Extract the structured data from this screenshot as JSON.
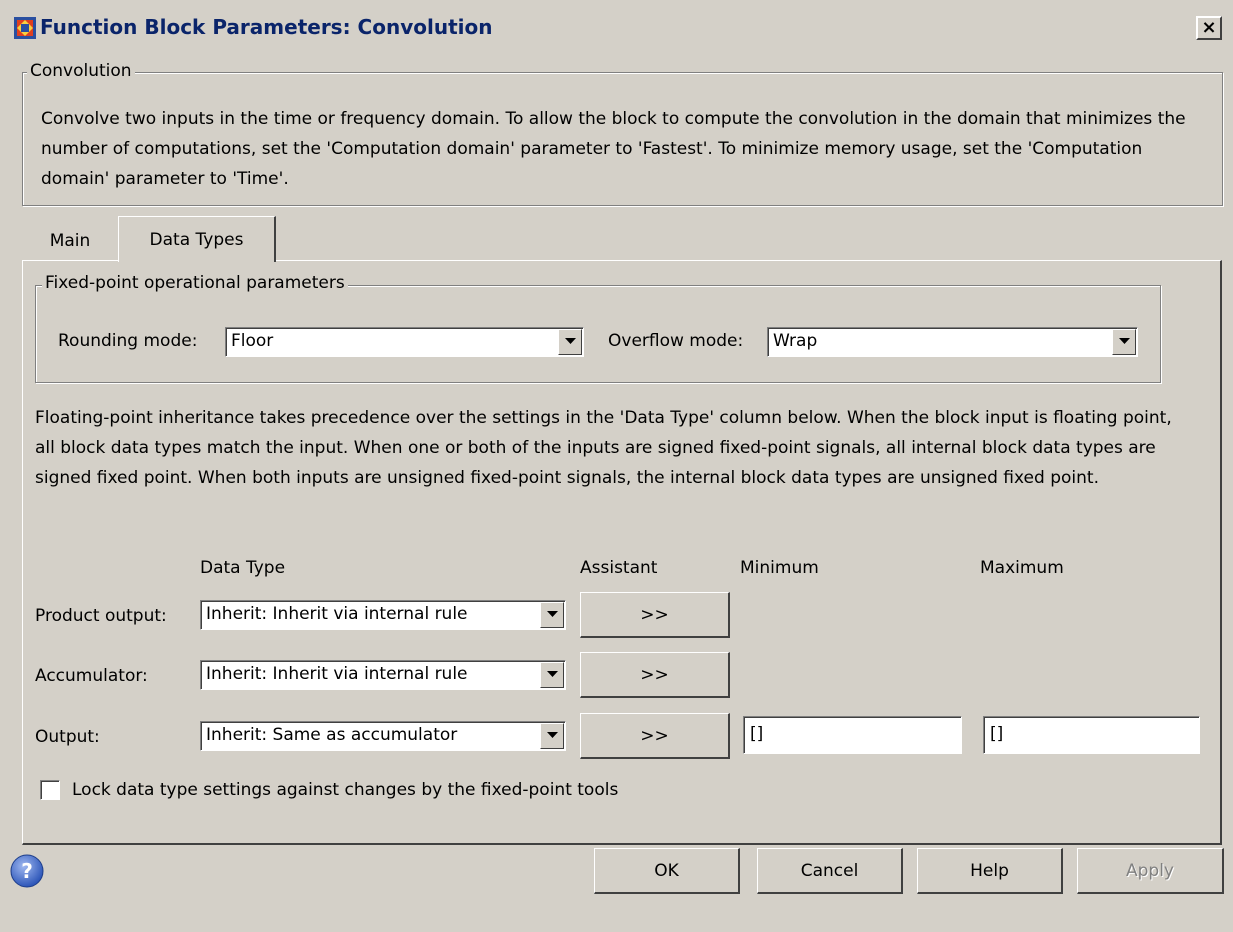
{
  "window": {
    "title": "Function Block Parameters: Convolution",
    "close_label": "×"
  },
  "block_group": {
    "legend": "Convolution",
    "description": "Convolve two inputs in the time or frequency domain. To allow the block to compute the convolution in the domain that minimizes the number of computations, set the 'Computation domain' parameter to 'Fastest'. To minimize memory usage, set the 'Computation domain' parameter to 'Time'."
  },
  "tabs": [
    {
      "label": "Main",
      "active": false
    },
    {
      "label": "Data Types",
      "active": true
    }
  ],
  "fixed_point": {
    "legend": "Fixed-point operational parameters",
    "rounding_label": "Rounding mode:",
    "rounding_value": "Floor",
    "overflow_label": "Overflow mode:",
    "overflow_value": "Wrap"
  },
  "inheritance_text": "Floating-point inheritance takes precedence over the settings in the 'Data Type' column below. When the block input is floating point, all block data types match the input. When one or both of the inputs are signed fixed-point signals, all internal block data types are signed fixed point. When both inputs are unsigned fixed-point signals, the internal block data types are unsigned fixed point.",
  "table": {
    "headers": {
      "data_type": "Data Type",
      "assistant": "Assistant",
      "minimum": "Minimum",
      "maximum": "Maximum"
    },
    "rows": [
      {
        "label": "Product output:",
        "data_type": "Inherit: Inherit via internal rule",
        "assistant": ">>"
      },
      {
        "label": "Accumulator:",
        "data_type": "Inherit: Inherit via internal rule",
        "assistant": ">>"
      },
      {
        "label": "Output:",
        "data_type": "Inherit: Same as accumulator",
        "assistant": ">>",
        "minimum": "[]",
        "maximum": "[]"
      }
    ]
  },
  "lock_checkbox": {
    "label": "Lock data type settings against changes by the fixed-point tools",
    "checked": false
  },
  "buttons": {
    "ok": "OK",
    "cancel": "Cancel",
    "help": "Help",
    "apply": "Apply"
  },
  "colors": {
    "dialog_bg": "#d4d0c8",
    "title_text": "#0a246a",
    "disabled_text": "#808080"
  }
}
